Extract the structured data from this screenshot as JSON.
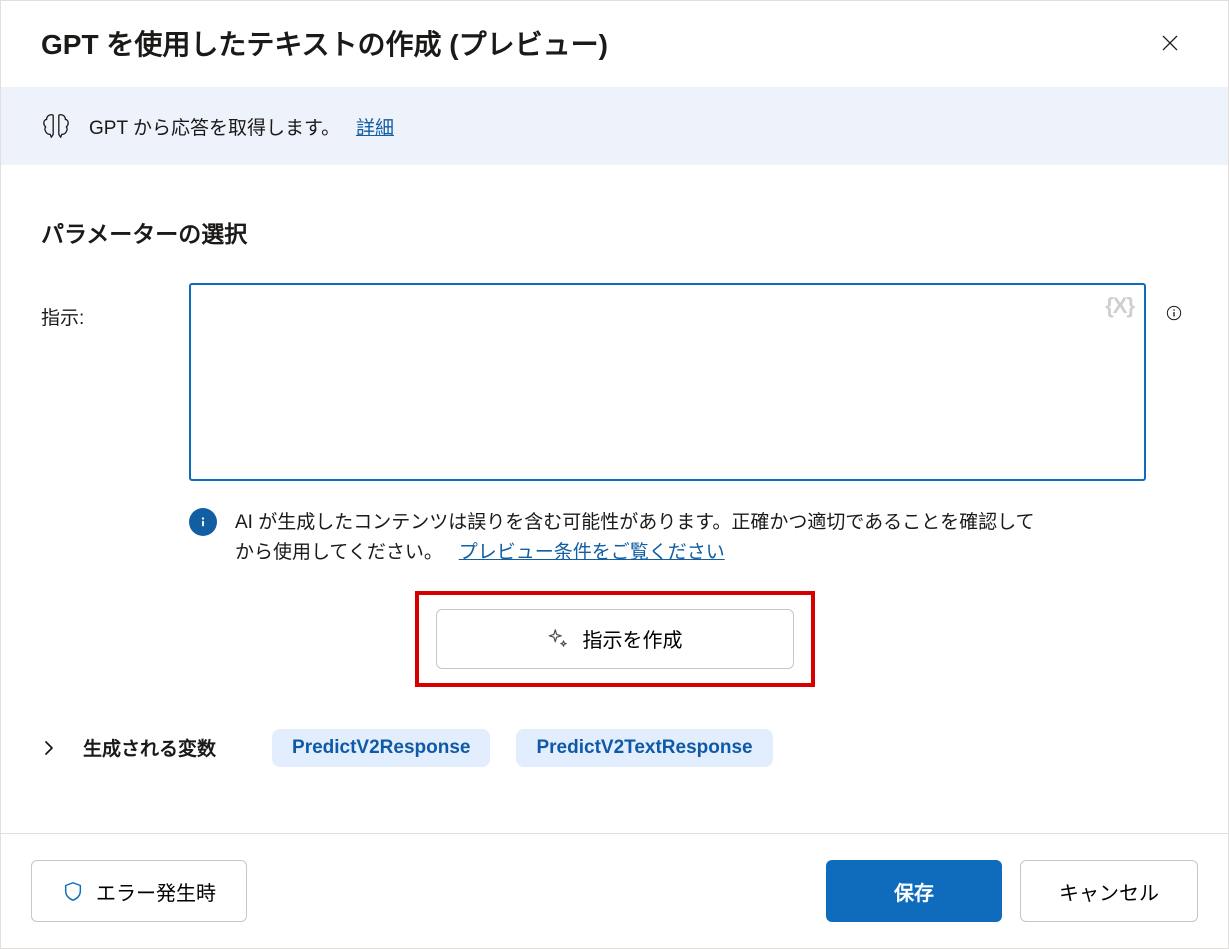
{
  "header": {
    "title": "GPT を使用したテキストの作成  (プレビュー)"
  },
  "banner": {
    "text": "GPT から応答を取得します。",
    "link": "詳細"
  },
  "section": {
    "title": "パラメーターの選択"
  },
  "field": {
    "label": "指示:",
    "value": "",
    "var_insert_glyph": "{X}"
  },
  "ai_warning": {
    "text": "AI が生成したコンテンツは誤りを含む可能性があります。正確かつ適切であることを確認してから使用してください。",
    "link": "プレビュー条件をご覧ください"
  },
  "create_button": {
    "label": "指示を作成"
  },
  "generated_vars": {
    "label": "生成される変数",
    "items": [
      "PredictV2Response",
      "PredictV2TextResponse"
    ]
  },
  "footer": {
    "error_button": "エラー発生時",
    "save": "保存",
    "cancel": "キャンセル"
  },
  "icons": {
    "close": "close-icon",
    "brain": "brain/gpt-icon",
    "info_circle": "info-circle-icon",
    "shield": "shield-icon",
    "sparkle": "sparkle-icon",
    "chevron_right": "chevron-right-icon",
    "info_small": "info-small-icon"
  },
  "colors": {
    "accent": "#0f6cbd",
    "link": "#115ea3",
    "banner_bg": "#eef2fb",
    "pill_bg": "#e2edfd",
    "highlight_border": "#d60000"
  }
}
